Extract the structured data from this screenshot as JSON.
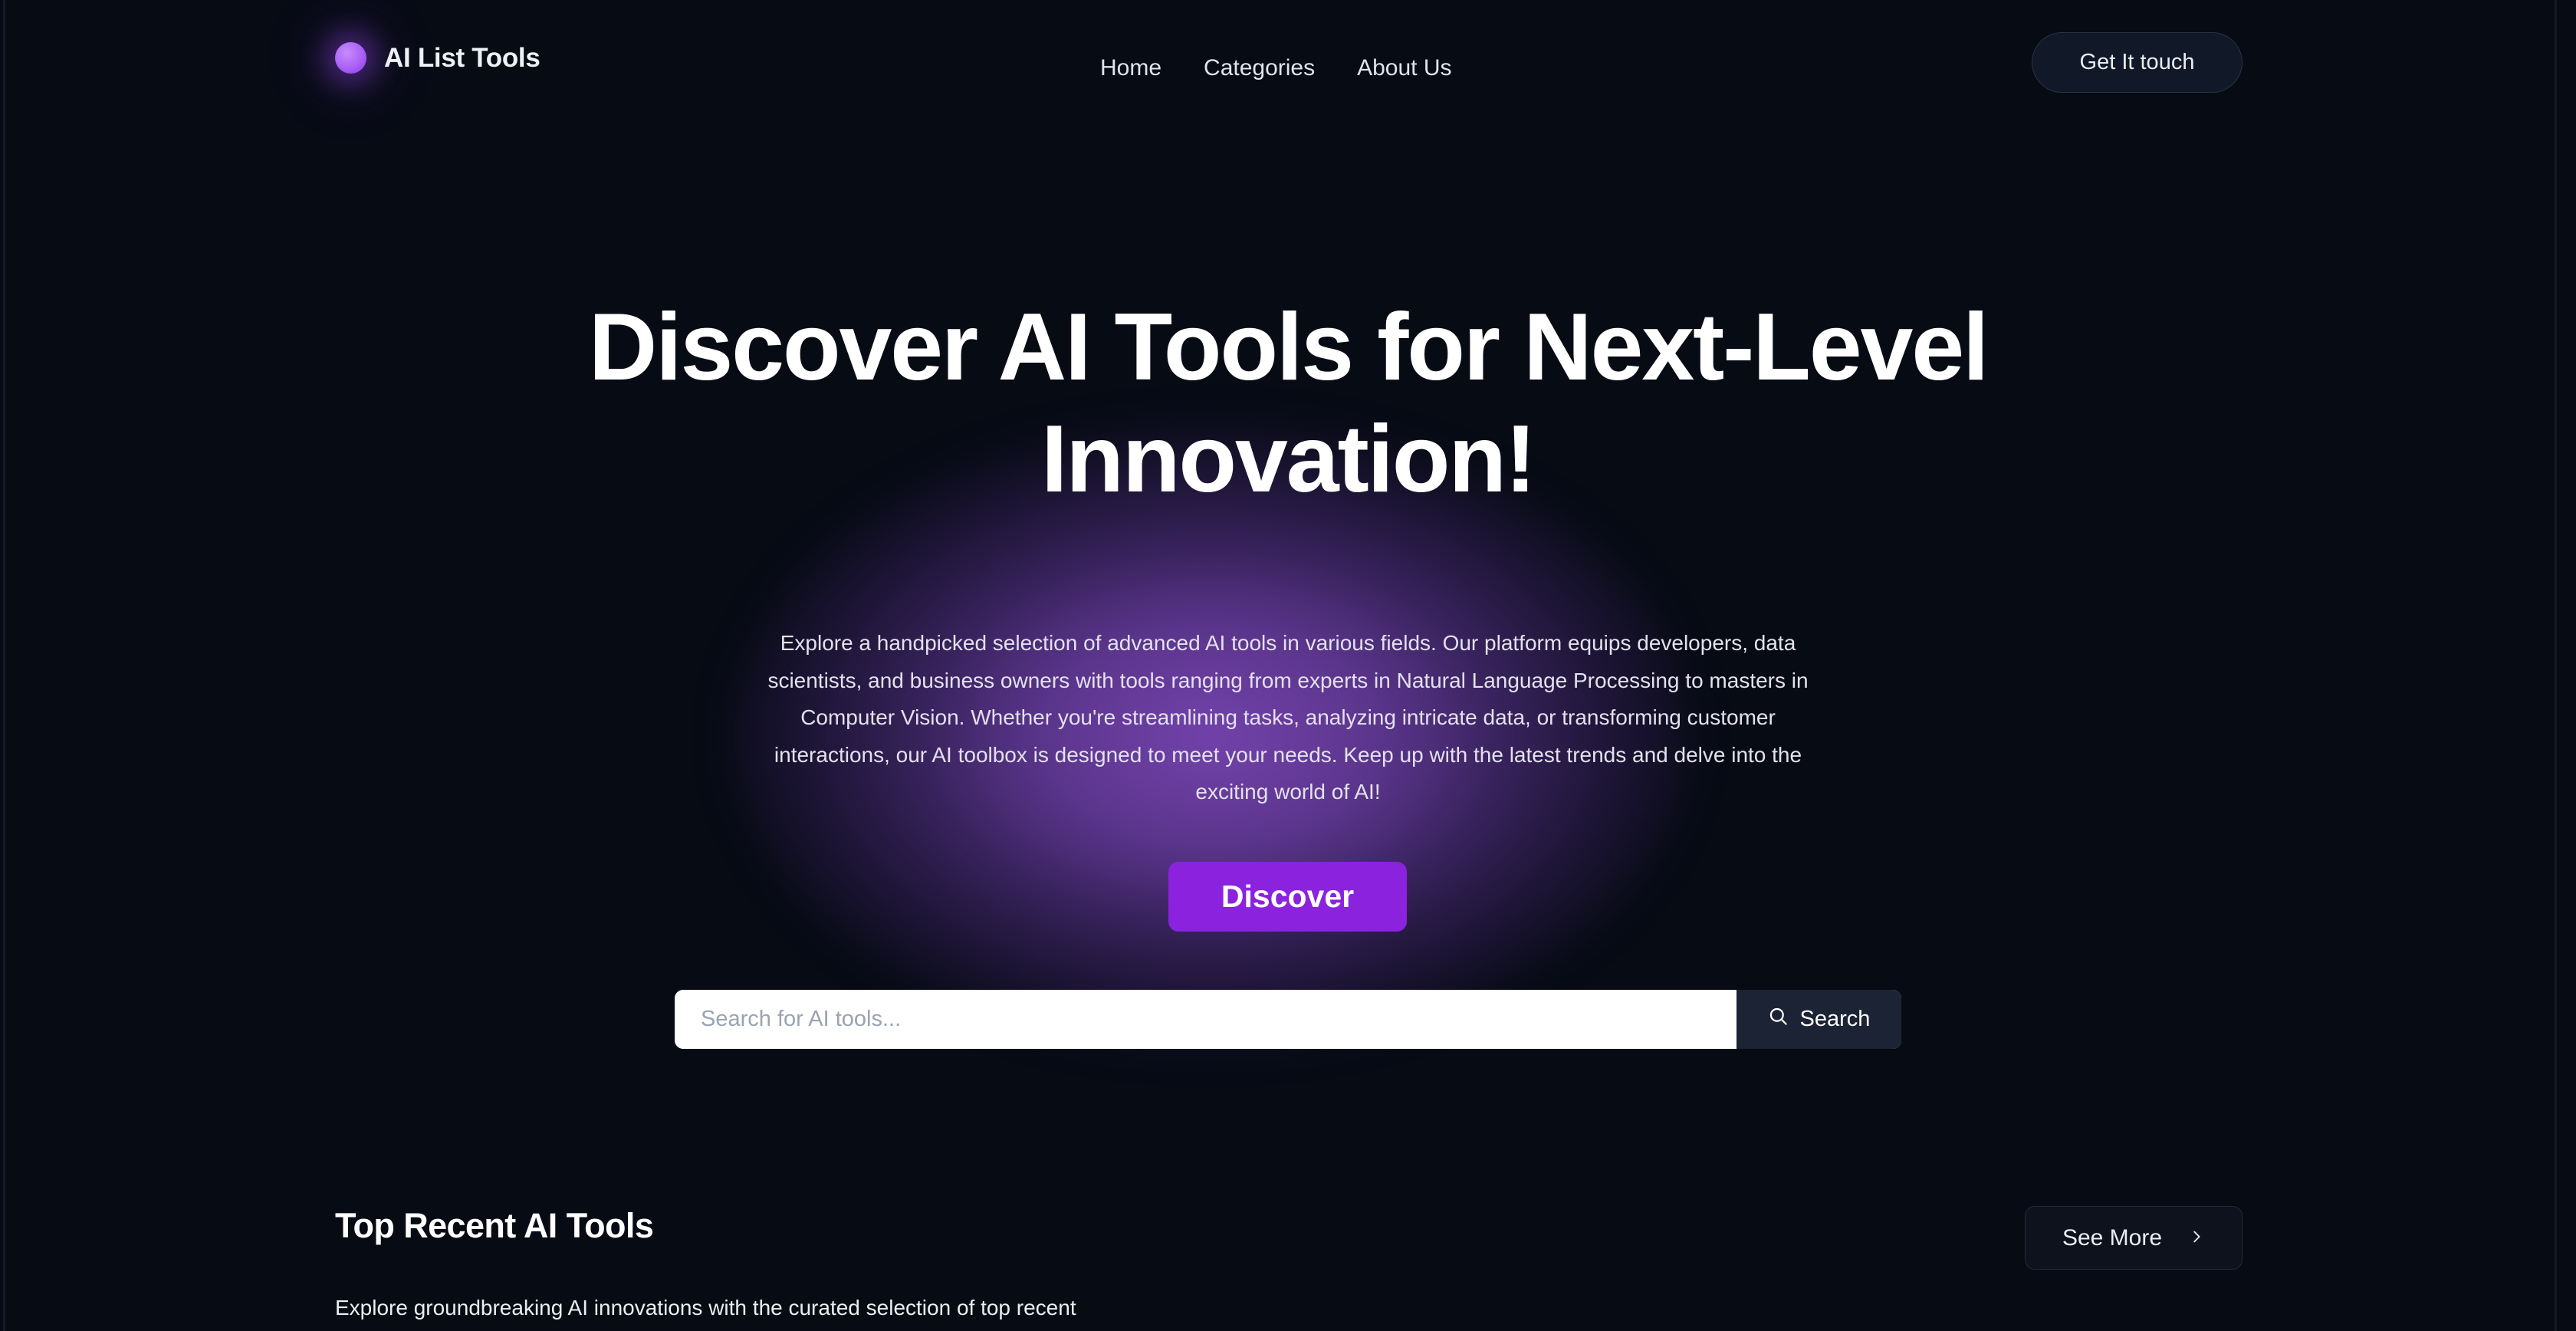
{
  "colors": {
    "background": "#070b14",
    "accent_purple": "#8b22dd",
    "logo_purple": "#a855f7",
    "glow_purple": "#7e48ba",
    "dark_panel": "#1b2334",
    "text_primary": "#ffffff",
    "text_muted": "#e3e1ee"
  },
  "header": {
    "brand_name": "AI List Tools",
    "logo_icon": "purple-circle-logo-icon",
    "nav": [
      {
        "label": "Home"
      },
      {
        "label": "Categories"
      },
      {
        "label": "About Us"
      }
    ],
    "cta_label": "Get It touch"
  },
  "hero": {
    "title": "Discover AI Tools for Next-Level Innovation!",
    "paragraph": "Explore a handpicked selection of advanced AI tools in various fields. Our platform equips developers, data scientists, and business owners with tools ranging from experts in Natural Language Processing to masters in Computer Vision. Whether you're streamlining tasks, analyzing intricate data, or transforming customer interactions, our AI toolbox is designed to meet your needs. Keep up with the latest trends and delve into the exciting world of AI!",
    "discover_label": "Discover"
  },
  "search": {
    "placeholder": "Search for AI tools...",
    "value": "",
    "button_label": "Search",
    "button_icon": "search-icon"
  },
  "section": {
    "title": "Top Recent AI Tools",
    "subtitle": "Explore groundbreaking AI innovations with the curated selection of top recent",
    "see_more_label": "See More",
    "see_more_icon": "chevron-right-icon"
  }
}
